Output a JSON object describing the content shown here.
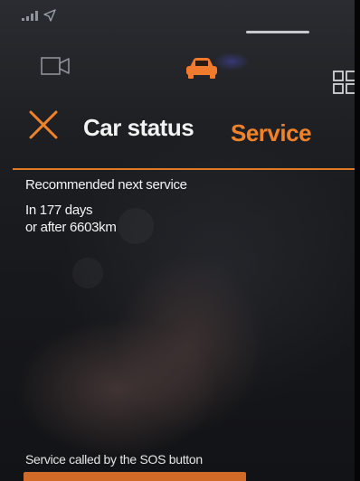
{
  "header": {
    "title": "Car status",
    "active_tab": "Service"
  },
  "service": {
    "heading": "Recommended next service",
    "days_line": "In 177 days",
    "distance_line": "or after 6603km"
  },
  "footer": {
    "sos_label": "Service called by the SOS button"
  },
  "icons": {
    "status": [
      "signal-icon",
      "navigation-arrow-icon"
    ],
    "top_bar": [
      "camera-icon",
      "car-icon",
      "app-grid-icon"
    ],
    "header": [
      "close-icon"
    ]
  },
  "colors": {
    "accent": "#f0832a",
    "divider": "#e07a26",
    "car_icon": "#f07a2e",
    "text": "#f4f4f4"
  }
}
